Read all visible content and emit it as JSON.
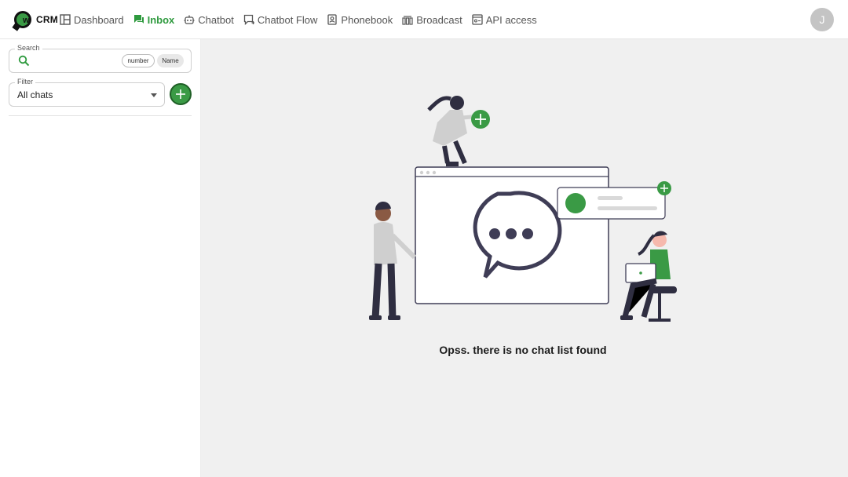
{
  "brand": {
    "logo_letter": "w",
    "name": "CRM"
  },
  "nav": {
    "items": [
      {
        "label": "Dashboard",
        "icon": "dashboard-icon",
        "active": false
      },
      {
        "label": "Inbox",
        "icon": "inbox-icon",
        "active": true
      },
      {
        "label": "Chatbot",
        "icon": "robot-icon",
        "active": false
      },
      {
        "label": "Chatbot Flow",
        "icon": "flow-icon",
        "active": false
      },
      {
        "label": "Phonebook",
        "icon": "contact-icon",
        "active": false
      },
      {
        "label": "Broadcast",
        "icon": "broadcast-icon",
        "active": false
      },
      {
        "label": "API access",
        "icon": "api-icon",
        "active": false
      }
    ]
  },
  "user": {
    "initial": "J"
  },
  "sidebar": {
    "search": {
      "label": "Search",
      "value": "",
      "chips": [
        "number",
        "Name"
      ]
    },
    "filter": {
      "label": "Filter",
      "value": "All chats"
    }
  },
  "main": {
    "empty_message": "Opss. there is no chat list found"
  },
  "colors": {
    "accent": "#3a9a45",
    "main_bg": "#f0f0f0",
    "figure_gray": "#cfcfcf",
    "figure_dark": "#2f2e41"
  }
}
